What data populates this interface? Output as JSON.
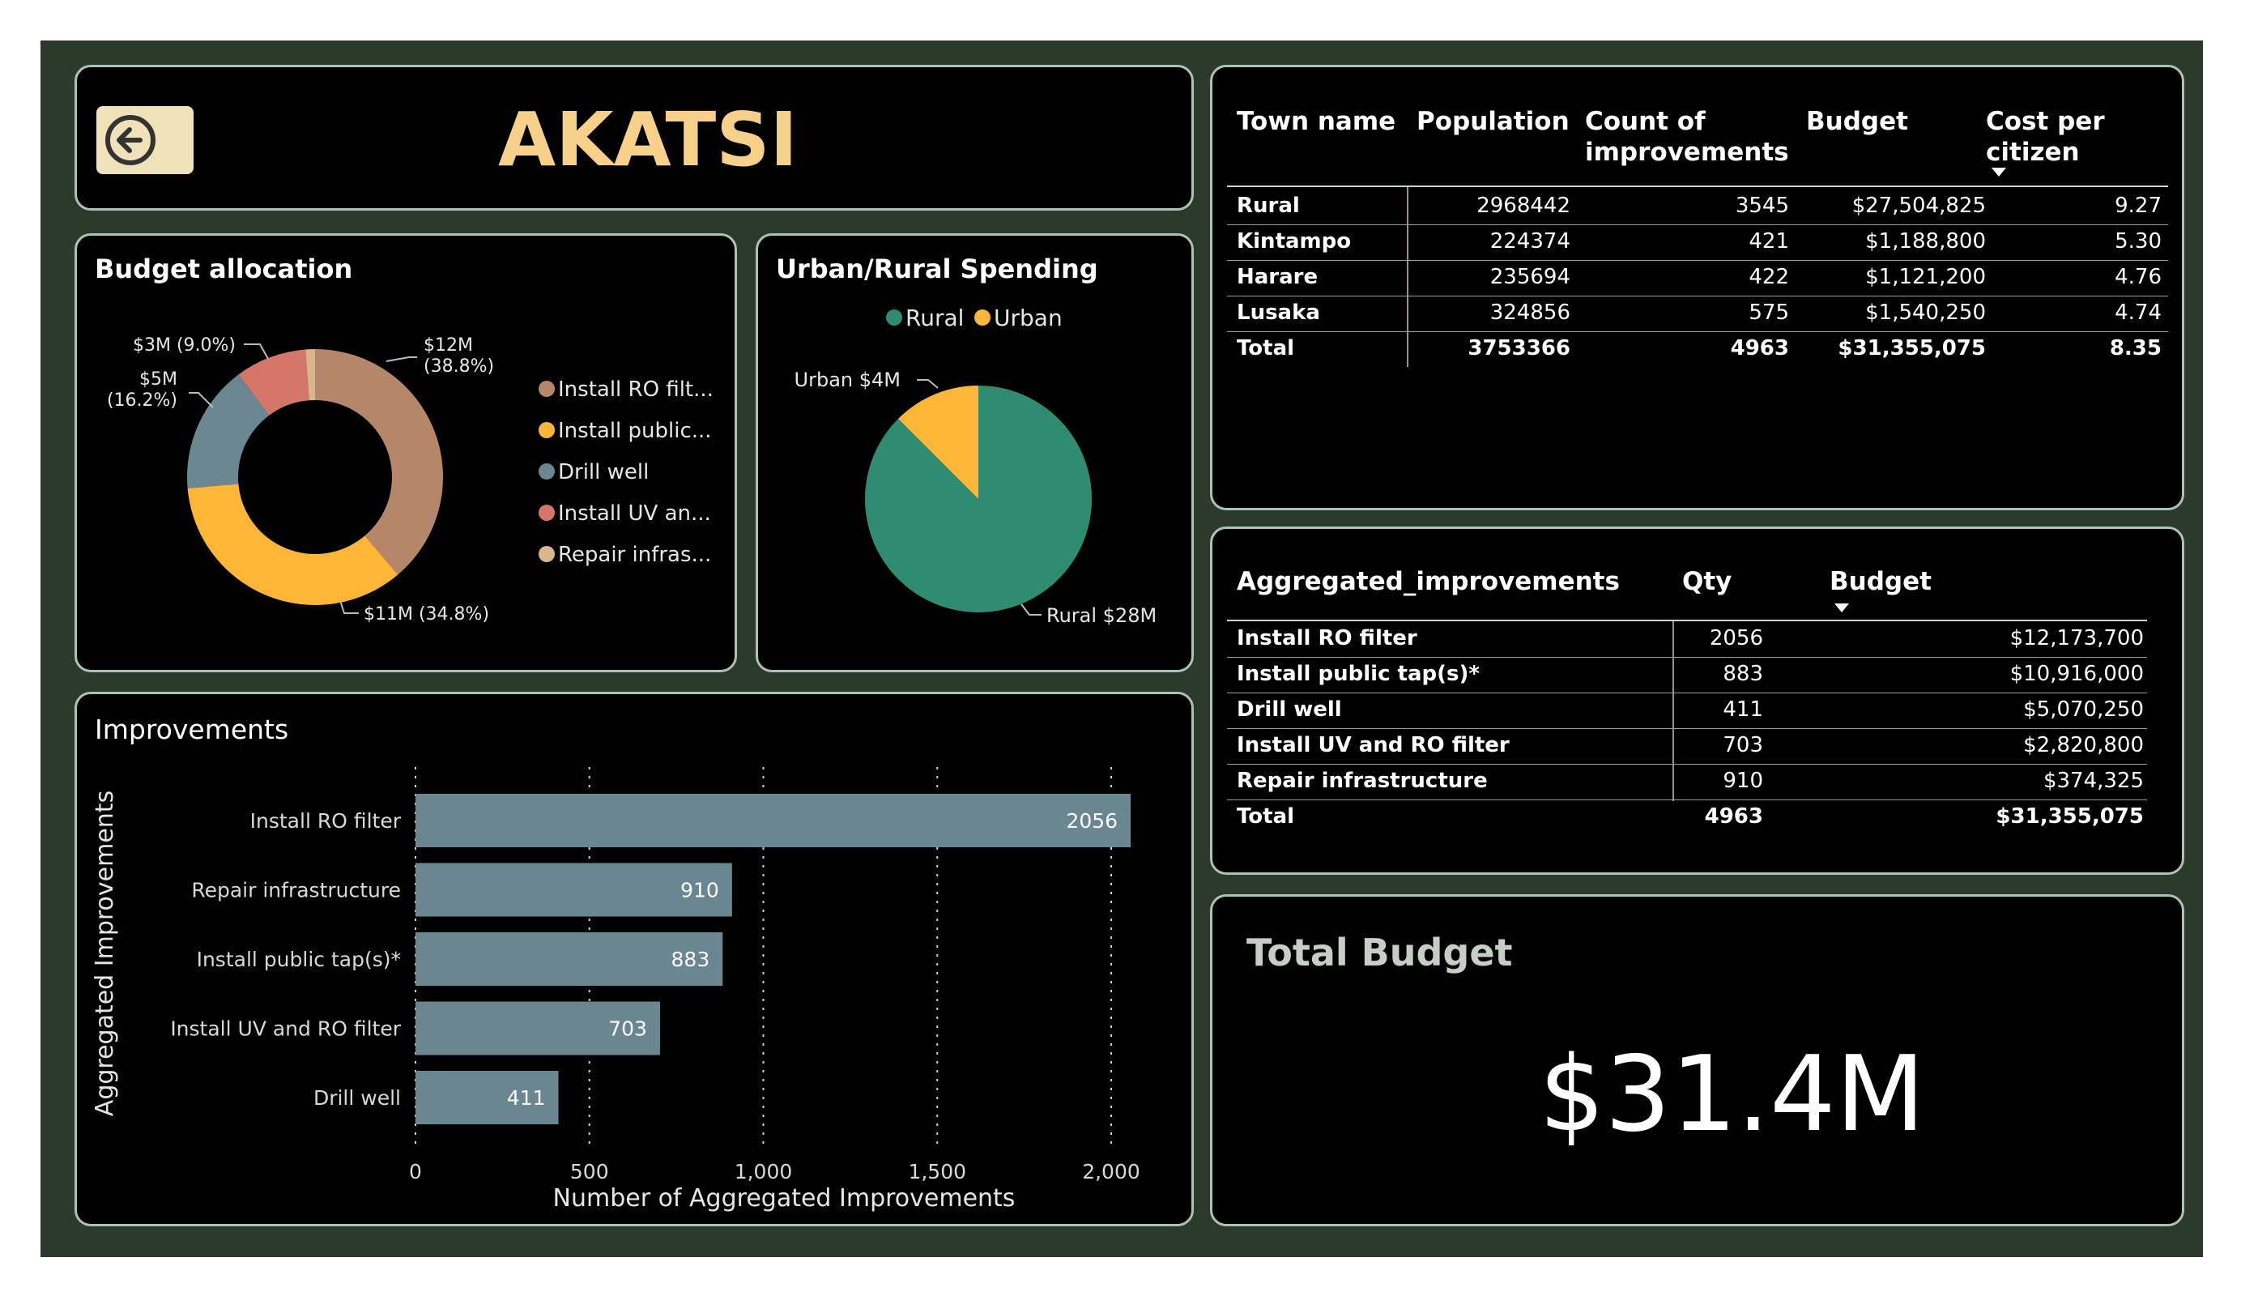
{
  "header": {
    "title": "AKATSI",
    "back_icon": "arrow-left-circle-icon"
  },
  "colors": {
    "title": "#f7d08a",
    "ro_filter": "#b5866a",
    "public_tap": "#ffb637",
    "drill_well": "#6b8791",
    "uv_ro": "#d5766a",
    "repair": "#d9b68e",
    "rural": "#2f8c73",
    "urban": "#ffb637",
    "bar": "#6a8791"
  },
  "budget_allocation": {
    "title": "Budget allocation",
    "legend": [
      "Install RO filt...",
      "Install public...",
      "Drill well",
      "Install UV an...",
      "Repair infras..."
    ]
  },
  "urban_rural": {
    "title": "Urban/Rural Spending",
    "legend": [
      "Rural",
      "Urban"
    ]
  },
  "improvements": {
    "title": "Improvements"
  },
  "town_table": {
    "headers": [
      "Town name",
      "Population",
      "Count of improvements",
      "Budget",
      "Cost per citizen"
    ],
    "rows": [
      [
        "Rural",
        "2968442",
        "3545",
        "$27,504,825",
        "9.27"
      ],
      [
        "Kintampo",
        "224374",
        "421",
        "$1,188,800",
        "5.30"
      ],
      [
        "Harare",
        "235694",
        "422",
        "$1,121,200",
        "4.76"
      ],
      [
        "Lusaka",
        "324856",
        "575",
        "$1,540,250",
        "4.74"
      ]
    ],
    "total": [
      "Total",
      "3753366",
      "4963",
      "$31,355,075",
      "8.35"
    ]
  },
  "agg_table": {
    "headers": [
      "Aggregated_improvements",
      "Qty",
      "Budget"
    ],
    "rows": [
      [
        "Install RO filter",
        "2056",
        "$12,173,700"
      ],
      [
        "Install public tap(s)*",
        "883",
        "$10,916,000"
      ],
      [
        "Drill well",
        "411",
        "$5,070,250"
      ],
      [
        "Install UV and RO filter",
        "703",
        "$2,820,800"
      ],
      [
        "Repair infrastructure",
        "910",
        "$374,325"
      ]
    ],
    "total": [
      "Total",
      "4963",
      "$31,355,075"
    ]
  },
  "total_budget": {
    "label": "Total Budget",
    "value": "$31.4M"
  },
  "chart_data": [
    {
      "type": "pie",
      "title": "Budget allocation",
      "donut": true,
      "categories": [
        "Install RO filt...",
        "Install public...",
        "Drill well",
        "Install UV an...",
        "Repair infras..."
      ],
      "values": [
        38.8,
        34.8,
        16.2,
        9.0,
        1.2
      ],
      "data_labels": [
        "$12M (38.8%)",
        "$11M (34.8%)",
        "$5M (16.2%)",
        "$3M (9.0%)",
        ""
      ],
      "legend": "right"
    },
    {
      "type": "pie",
      "title": "Urban/Rural Spending",
      "categories": [
        "Rural",
        "Urban"
      ],
      "values": [
        28,
        4
      ],
      "data_labels": [
        "Rural $28M",
        "Urban $4M"
      ],
      "legend": "top"
    },
    {
      "type": "bar",
      "orientation": "horizontal",
      "title": "Improvements",
      "categories": [
        "Install RO filter",
        "Repair infrastructure",
        "Install public tap(s)*",
        "Install UV and RO filter",
        "Drill well"
      ],
      "values": [
        2056,
        910,
        883,
        703,
        411
      ],
      "xlabel": "Number of Aggregated Improvements",
      "ylabel": "Aggregated Improvements",
      "xlim": [
        0,
        2100
      ],
      "xticks": [
        "0",
        "500",
        "1,000",
        "1,500",
        "2,000"
      ],
      "grid": true
    }
  ]
}
